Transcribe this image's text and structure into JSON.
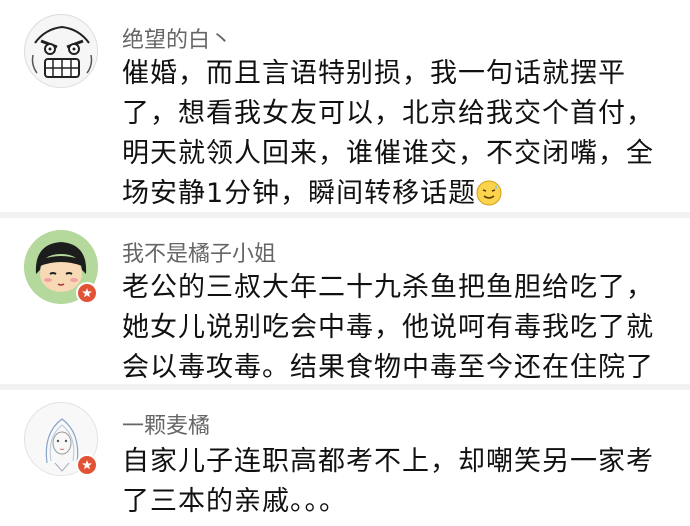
{
  "comments": [
    {
      "username": "绝望的白丶",
      "lines": [
        "催婚，而且言语特别损，我一句话就摆平",
        "了，想看我女友可以，北京给我交个首付，",
        "明天就领人回来，谁催谁交，不交闭嘴，全",
        "场安静1分钟，瞬间转移话题"
      ],
      "emoji": "sweat-smile-emoji",
      "avatar": "rage-face-avatar"
    },
    {
      "username": "我不是橘子小姐",
      "lines": [
        "老公的三叔大年二十九杀鱼把鱼胆给吃了，",
        "她女儿说别吃会中毒，他说呵有毒我吃了就",
        "会以毒攻毒。结果食物中毒至今还在住院了"
      ],
      "avatar": "cartoon-girl-avatar",
      "badge": "weibo-verified-badge"
    },
    {
      "username": "一颗麦橘",
      "lines": [
        "自家儿子连职高都考不上，却嘲笑另一家考",
        "了三本的亲戚。。。"
      ],
      "avatar": "anime-sketch-avatar",
      "badge": "weibo-verified-badge"
    }
  ],
  "colors": {
    "badge": "#e25336",
    "divider": "#e6e6e6",
    "username": "#666666",
    "text": "#111111"
  }
}
